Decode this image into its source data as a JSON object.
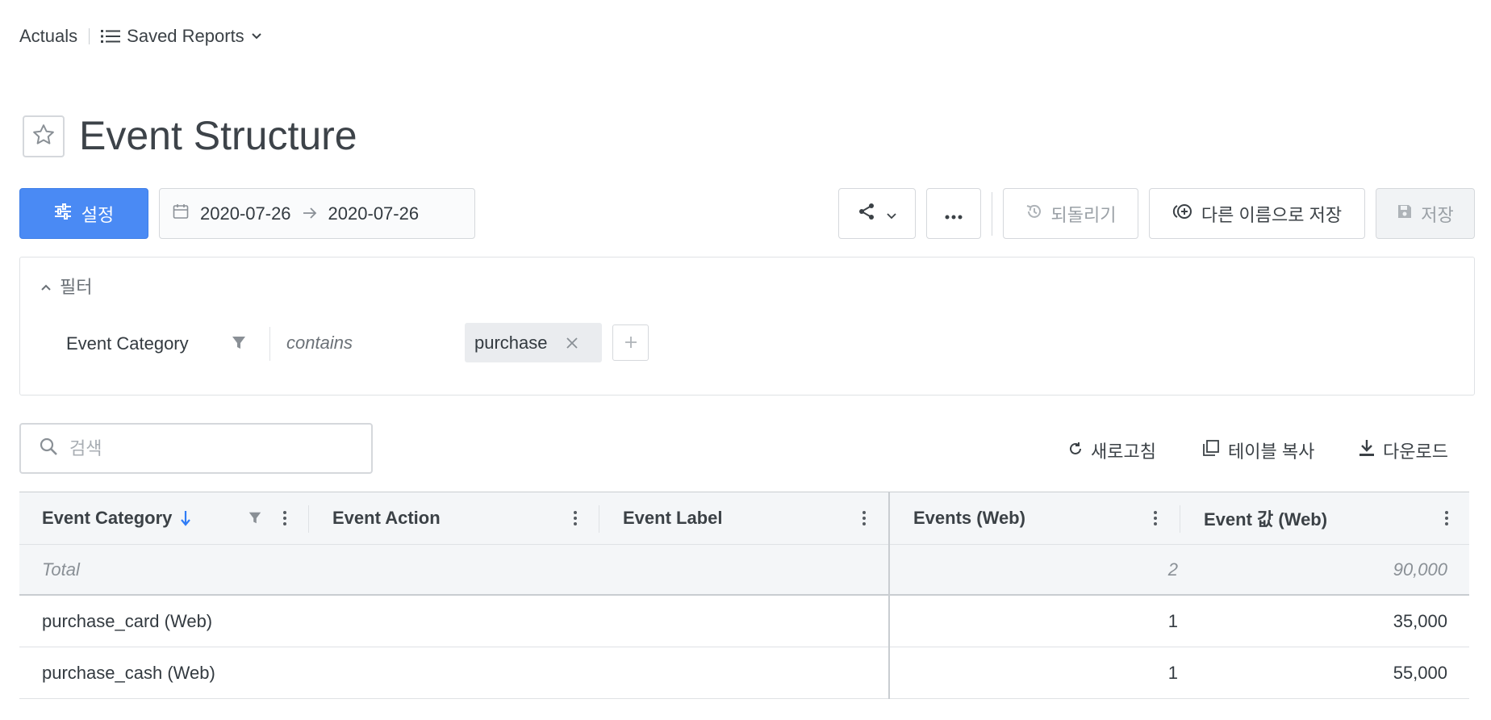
{
  "breadcrumb": {
    "root": "Actuals",
    "saved_reports": "Saved Reports"
  },
  "page": {
    "title": "Event Structure"
  },
  "toolbar": {
    "settings_label": "설정",
    "date_start": "2020-07-26",
    "date_end": "2020-07-26",
    "revert_label": "되돌리기",
    "save_as_label": "다른 이름으로 저장",
    "save_label": "저장"
  },
  "filter": {
    "toggle_label": "필터",
    "field": "Event Category",
    "operator": "contains",
    "value": "purchase"
  },
  "search": {
    "placeholder": "검색"
  },
  "table_actions": {
    "refresh": "새로고침",
    "copy_table": "테이블 복사",
    "download": "다운로드"
  },
  "table": {
    "columns": [
      "Event Category",
      "Event Action",
      "Event Label",
      "Events (Web)",
      "Event 값 (Web)"
    ],
    "total": {
      "label": "Total",
      "events": "2",
      "value": "90,000"
    },
    "rows": [
      {
        "category": "purchase_card (Web)",
        "events": "1",
        "value": "35,000"
      },
      {
        "category": "purchase_cash (Web)",
        "events": "1",
        "value": "55,000"
      }
    ]
  },
  "colors": {
    "primary": "#4a8af4",
    "sort_arrow": "#2f7cf6"
  },
  "icons": [
    "list-icon",
    "chevron-down-icon",
    "star-icon",
    "sliders-icon",
    "calendar-icon",
    "arrow-right-icon",
    "share-icon",
    "more-horizontal-icon",
    "history-icon",
    "save-as-icon",
    "save-icon",
    "chevron-up-icon",
    "funnel-icon",
    "close-icon",
    "plus-icon",
    "search-icon",
    "refresh-icon",
    "copy-icon",
    "download-icon",
    "sort-down-icon",
    "kebab-icon"
  ]
}
